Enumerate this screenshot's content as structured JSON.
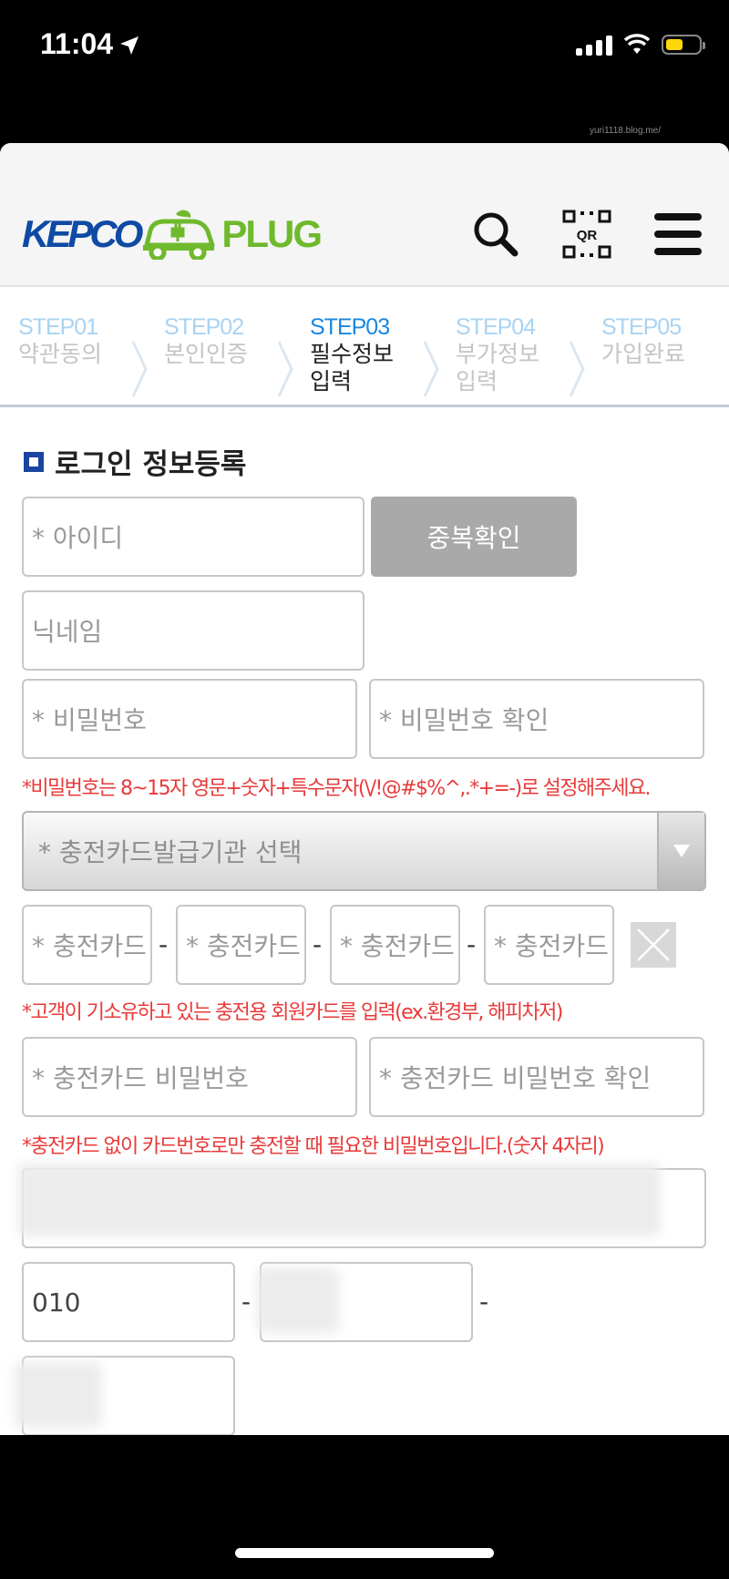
{
  "status_bar": {
    "time": "11:04"
  },
  "watermark": "yuri1118.blog.me/",
  "logo": {
    "part1": "KEPCO",
    "part2": "PLUG"
  },
  "header_icons": {
    "search": "search-icon",
    "qr": "qr-icon",
    "qr_text": "QR",
    "menu": "menu-icon"
  },
  "steps": [
    {
      "num": "STEP01",
      "label": "약관동의",
      "active": false
    },
    {
      "num": "STEP02",
      "label": "본인인증",
      "active": false
    },
    {
      "num": "STEP03",
      "label": "필수정보\n입력",
      "active": true
    },
    {
      "num": "STEP04",
      "label": "부가정보\n입력",
      "active": false
    },
    {
      "num": "STEP05",
      "label": "가입완료",
      "active": false
    }
  ],
  "section": {
    "title": "로그인 정보등록"
  },
  "form": {
    "id_placeholder": "* 아이디",
    "dup_check_label": "중복확인",
    "nickname_placeholder": "닉네임",
    "password_placeholder": "* 비밀번호",
    "password_confirm_placeholder": "* 비밀번호 확인",
    "password_note": "*비밀번호는 8~15자 영문+숫자+특수문자(\\/!@#$%^,.*+=-)로 설정해주세요.",
    "card_issuer_select": "* 충전카드발급기관 선택",
    "card_number_placeholder": "* 충전카드",
    "card_sep": "-",
    "card_note": "*고객이 기소유하고 있는 충전용 회원카드를 입력(ex.환경부, 해피차저)",
    "card_pw_placeholder": "* 충전카드 비밀번호",
    "card_pw_confirm_placeholder": "* 충전카드 비밀번호 확인",
    "card_pw_note": "*충전카드 없이 카드번호로만 충전할 때 필요한 비밀번호입니다.(숫자 4자리)",
    "phone_prefix": "010",
    "phone_sep": "-"
  },
  "colors": {
    "brand_blue": "#0f4aa4",
    "brand_green": "#6fb92c",
    "active_step": "#1a86e0",
    "note_red": "#e83a3a"
  }
}
